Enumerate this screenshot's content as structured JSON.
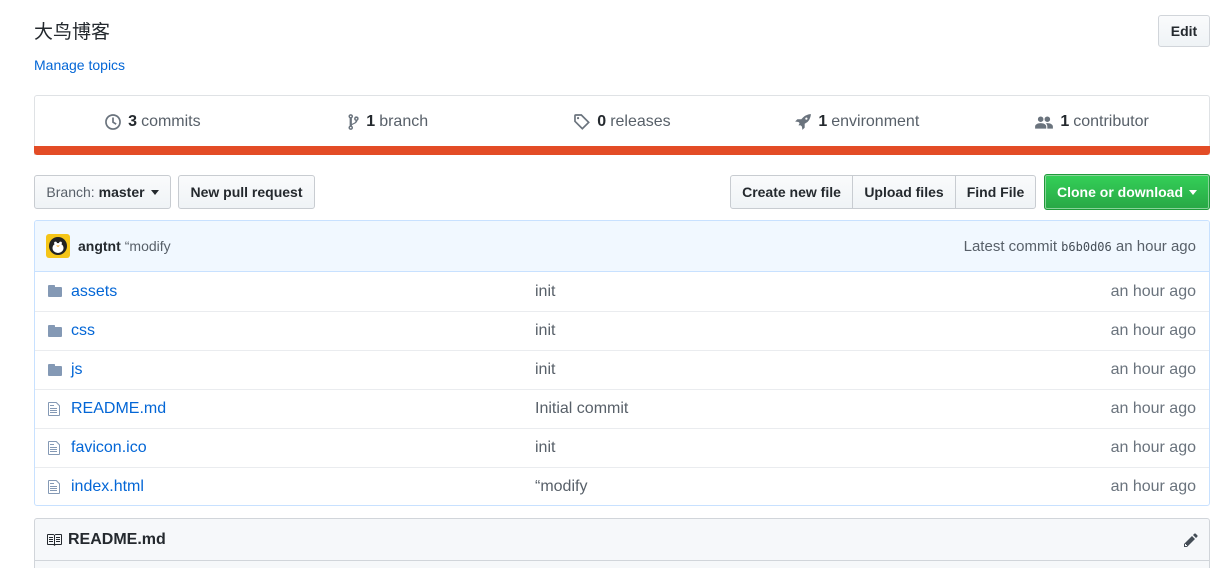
{
  "repo": {
    "description": "大鸟博客",
    "manage_topics": "Manage topics",
    "edit": "Edit"
  },
  "numbers": {
    "commits": {
      "count": "3",
      "label": "commits"
    },
    "branches": {
      "count": "1",
      "label": "branch"
    },
    "releases": {
      "count": "0",
      "label": "releases"
    },
    "environments": {
      "count": "1",
      "label": "environment"
    },
    "contributors": {
      "count": "1",
      "label": "contributor"
    }
  },
  "language_bar_color": "#e34c26",
  "toolbar": {
    "branch_label": "Branch:",
    "branch_value": "master",
    "new_pr": "New pull request",
    "create_file": "Create new file",
    "upload_files": "Upload files",
    "find_file": "Find File",
    "clone": "Clone or download"
  },
  "latest_commit": {
    "author": "angtnt",
    "message": "“modify",
    "prefix": "Latest commit",
    "sha": "b6b0d06",
    "age": "an hour ago"
  },
  "files": [
    {
      "name": "assets",
      "type": "folder",
      "message": "init",
      "age": "an hour ago"
    },
    {
      "name": "css",
      "type": "folder",
      "message": "init",
      "age": "an hour ago"
    },
    {
      "name": "js",
      "type": "folder",
      "message": "init",
      "age": "an hour ago"
    },
    {
      "name": "README.md",
      "type": "file",
      "message": "Initial commit",
      "age": "an hour ago"
    },
    {
      "name": "favicon.ico",
      "type": "file",
      "message": "init",
      "age": "an hour ago"
    },
    {
      "name": "index.html",
      "type": "file",
      "message": "“modify",
      "age": "an hour ago"
    }
  ],
  "readme": {
    "title": "README.md"
  }
}
